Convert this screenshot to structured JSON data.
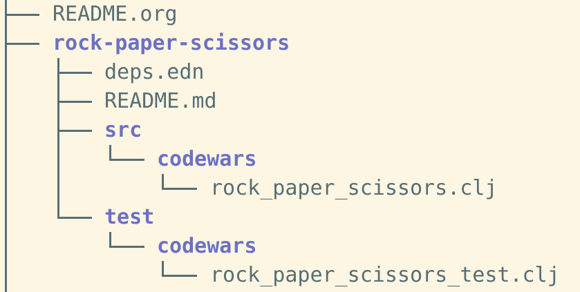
{
  "tree": {
    "entries": [
      {
        "name": "README.org",
        "type": "file",
        "depth": 0
      },
      {
        "name": "rock-paper-scissors",
        "type": "dir",
        "depth": 0
      },
      {
        "name": "deps.edn",
        "type": "file",
        "depth": 1
      },
      {
        "name": "README.md",
        "type": "file",
        "depth": 1
      },
      {
        "name": "src",
        "type": "dir",
        "depth": 1
      },
      {
        "name": "codewars",
        "type": "dir",
        "depth": 2
      },
      {
        "name": "rock_paper_scissors.clj",
        "type": "file",
        "depth": 3
      },
      {
        "name": "test",
        "type": "dir",
        "depth": 1
      },
      {
        "name": "codewars",
        "type": "dir",
        "depth": 2
      },
      {
        "name": "rock_paper_scissors_test.clj",
        "type": "file",
        "depth": 3
      }
    ]
  },
  "colors": {
    "background": "#fdf6e3",
    "file_text": "#586e75",
    "dir_text": "#6c71c4",
    "tree_lines": "#586e75"
  }
}
